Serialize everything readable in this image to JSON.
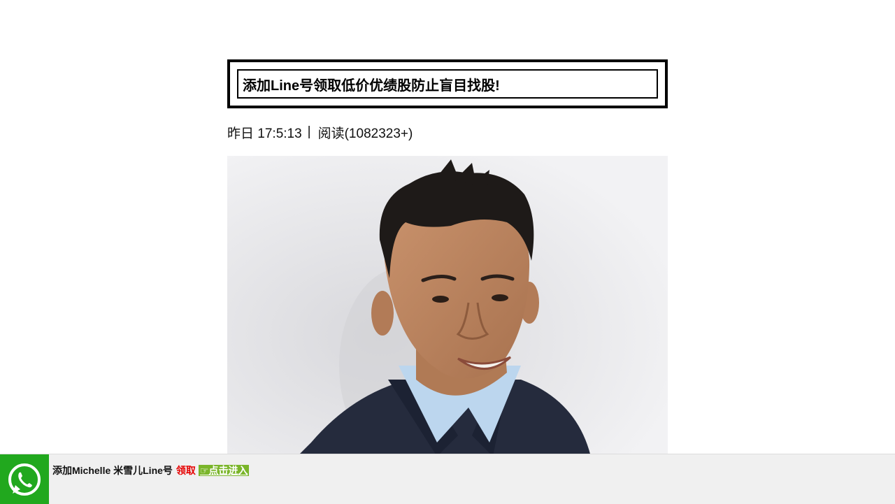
{
  "article": {
    "title": "添加Line号领取低价优绩股防止盲目找股!",
    "date": "昨日 17:5:13",
    "separator": "|",
    "reads": "阅读(1082323+)"
  },
  "bottom_bar": {
    "icon": "whatsapp-icon",
    "text": "添加Michelle 米雪儿Line号",
    "claim_label": "领取",
    "enter_label": "☞点击进入"
  },
  "colors": {
    "whatsapp_green": "#21a81e",
    "claim_red": "#e60000",
    "enter_button": "#7ab52a"
  }
}
